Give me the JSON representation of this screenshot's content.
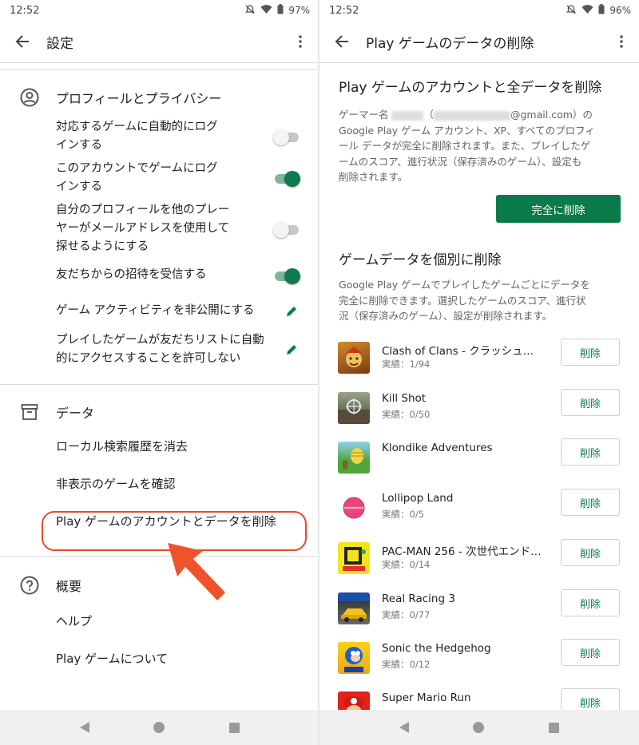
{
  "left": {
    "status": {
      "time": "12:52",
      "battery": "97%"
    },
    "appbar": {
      "title": "設定"
    },
    "profile": {
      "title": "プロフィールとプライバシー",
      "rows": [
        {
          "label": "対応するゲームに自動的にログインする",
          "line1": "対応するゲームに自動的にログ",
          "line2": "インする",
          "control": "toggle",
          "state": "off"
        },
        {
          "label": "このアカウントでゲームにログインする",
          "line1": "このアカウントでゲームにログ",
          "line2": "インする",
          "control": "toggle",
          "state": "on"
        },
        {
          "label": "自分のプロフィールを他のプレーヤーがメールアドレスを使用して探せるようにする",
          "line1": "自分のプロフィールを他のプレー",
          "line2": "ヤーがメールアドレスを使用して",
          "line3": "探せるようにする",
          "control": "toggle",
          "state": "off"
        },
        {
          "label": "友だちからの招待を受信する",
          "control": "toggle",
          "state": "on"
        },
        {
          "label": "ゲーム アクティビティを非公開にする",
          "control": "edit"
        },
        {
          "label": "プレイしたゲームが友だちリストに自動的にアクセスすることを許可しない",
          "line1": "プレイしたゲームが友だちリストに自動",
          "line2": "的にアクセスすることを許可しない",
          "control": "edit"
        }
      ]
    },
    "data_section": {
      "title": "データ",
      "items": [
        "ローカル検索履歴を消去",
        "非表示のゲームを確認",
        "Play ゲームのアカウントとデータを削除"
      ]
    },
    "about": {
      "title": "概要",
      "items": [
        "ヘルプ",
        "Play ゲームについて"
      ]
    },
    "colors": {
      "toggle_on": "#0f7a4c",
      "highlight": "#ea4a2c"
    }
  },
  "right": {
    "status": {
      "time": "12:52",
      "battery": "96%"
    },
    "appbar": {
      "title": "Play ゲームのデータの削除"
    },
    "full_delete": {
      "title": "Play ゲームのアカウントと全データを削除",
      "desc_prefix": "ゲーマー名 ",
      "desc_email": "@gmail.com）の",
      "desc_line2": "Google Play ゲーム アカウント、XP、すべてのプロフィ",
      "desc_line3": "ール データが完全に削除されます。また、プレイしたゲ",
      "desc_line4": "ームのスコア、進行状況（保存済みのゲーム）、設定も",
      "desc_line5": "削除されます。",
      "button": "完全に削除"
    },
    "per_game": {
      "title": "ゲームデータを個別に削除",
      "desc_line1": "Google Play ゲームでプレイしたゲームごとにデータを",
      "desc_line2": "完全に削除できます。選択したゲームのスコア、進行状",
      "desc_line3": "況（保存済みのゲーム）、設定が削除されます。",
      "delete_label": "削除",
      "games": [
        {
          "name": "Clash of Clans - クラッシュ・…",
          "progress": "実績：1/94"
        },
        {
          "name": "Kill Shot",
          "progress": "実績：0/50"
        },
        {
          "name": "Klondike Adventures",
          "progress": ""
        },
        {
          "name": "Lollipop Land",
          "progress": "実績：0/5"
        },
        {
          "name": "PAC-MAN 256 - 次世代エンド…",
          "progress": "実績：0/14"
        },
        {
          "name": "Real Racing 3",
          "progress": "実績：0/77"
        },
        {
          "name": "Sonic the Hedgehog",
          "progress": "実績：0/12"
        },
        {
          "name": "Super Mario Run",
          "progress": ""
        }
      ]
    },
    "colors": {
      "primary_button": "#0b7a4b"
    }
  }
}
